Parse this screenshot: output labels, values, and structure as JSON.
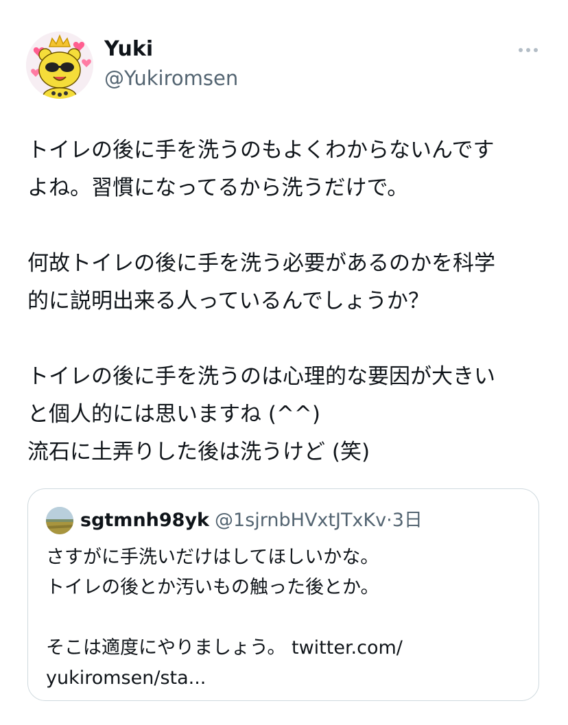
{
  "author": {
    "display_name": "Yuki",
    "handle": "@Yukiromsen",
    "avatar_icon": "yellow-bear-with-crown-and-sunglasses-avatar"
  },
  "more_icon": "more-horizontal-icon",
  "tweet_text": "トイレの後に手を洗うのもよくわからないんです\nよね。習慣になってるから洗うだけで。\n\n何故トイレの後に手を洗う必要があるのかを科学\n的に説明出来る人っているんでしょうか？\n\nトイレの後に手を洗うのは心理的な要因が大きい\nと個人的には思いますね (^^)\n流石に土弄りした後は洗うけど (笑)",
  "quoted_tweet": {
    "display_name": "sgtmnh98yk",
    "handle": "@1sjrnbHVxtJTxKv",
    "separator": "·",
    "time": "3日",
    "avatar_icon": "landscape-field-avatar",
    "text": "さすがに手洗いだけはしてほしいかな。\nトイレの後とか汚いもの触った後とか。\n\nそこは適度にやりましょう。",
    "link_text": "twitter.com/\nyukiromsen/sta..."
  },
  "colors": {
    "primary_text": "#0f1419",
    "secondary_text": "#536471",
    "border": "#cfd9de"
  }
}
